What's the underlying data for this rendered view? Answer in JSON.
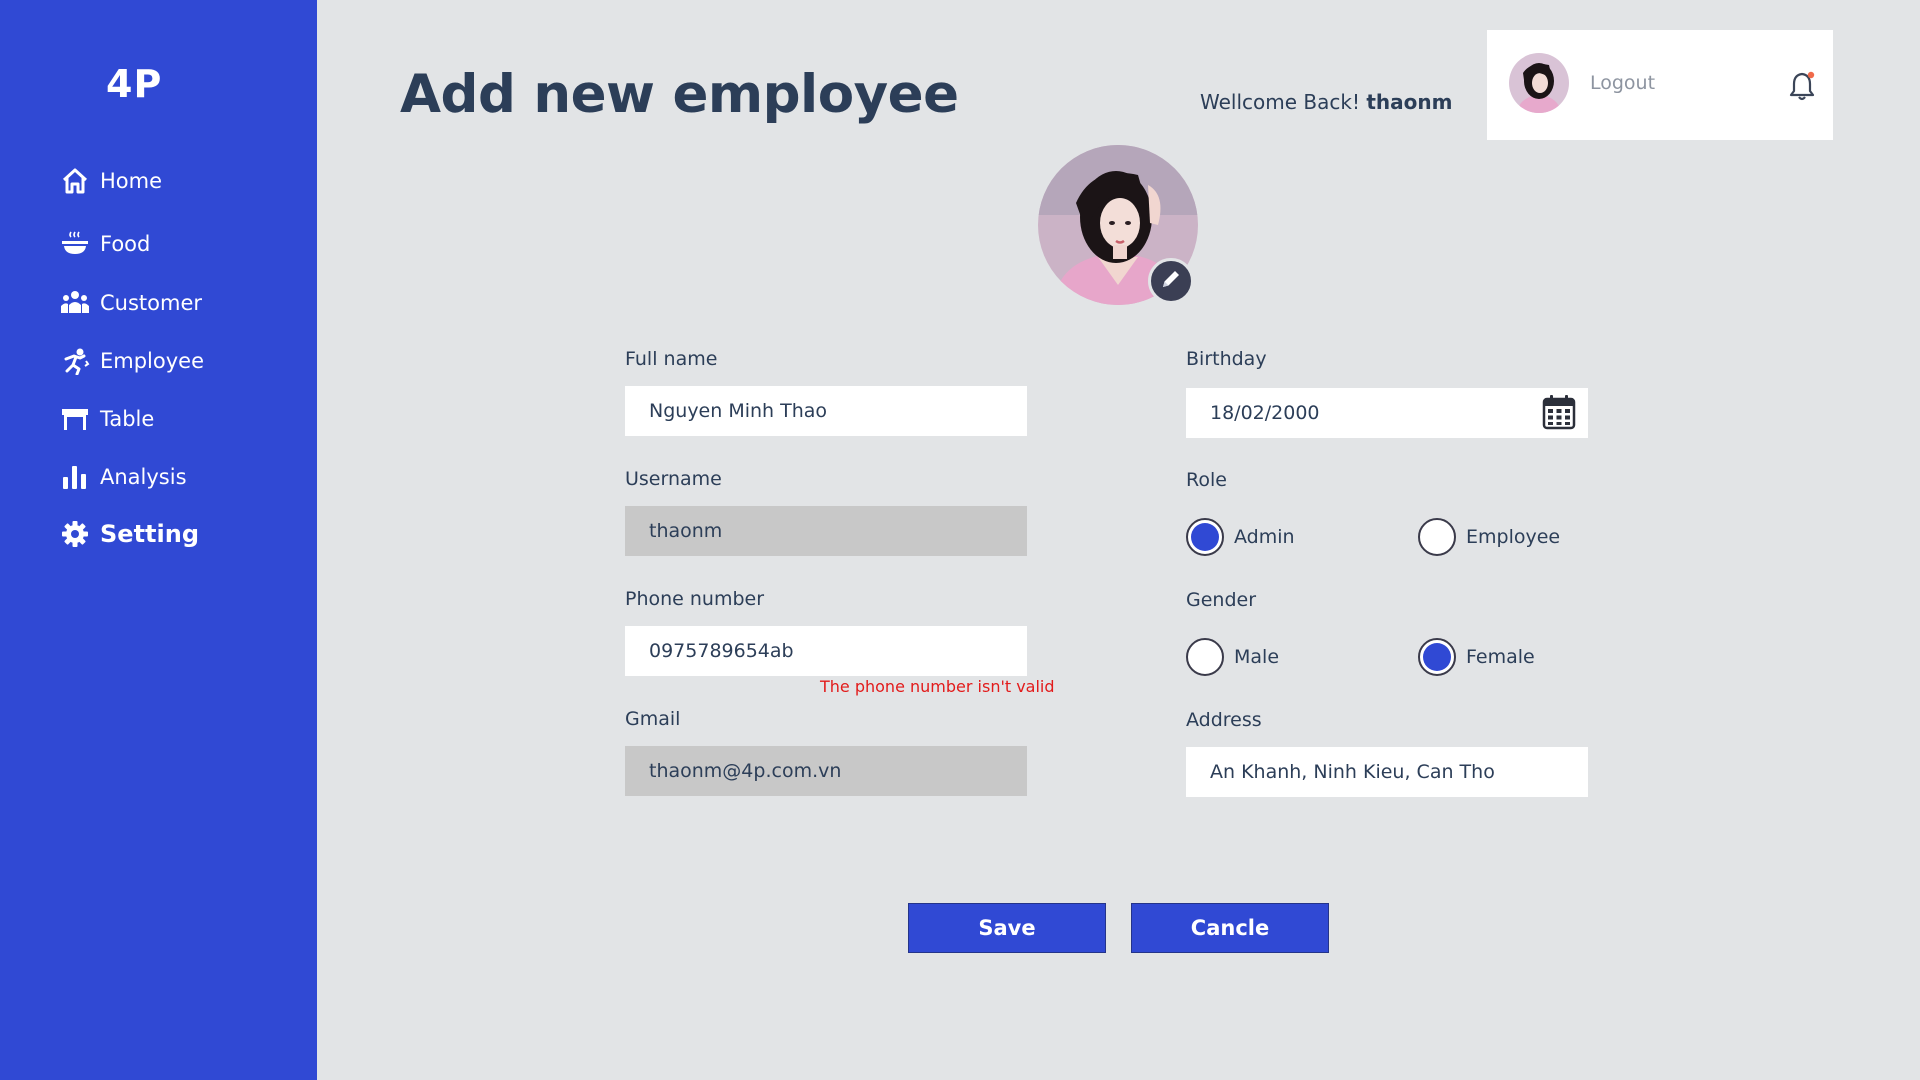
{
  "sidebar": {
    "logo": "4P",
    "items": [
      {
        "label": "Home",
        "icon": "home-icon"
      },
      {
        "label": "Food",
        "icon": "food-bowl-icon"
      },
      {
        "label": "Customer",
        "icon": "customers-icon"
      },
      {
        "label": "Employee",
        "icon": "employee-icon"
      },
      {
        "label": "Table",
        "icon": "table-icon"
      },
      {
        "label": "Analysis",
        "icon": "bar-chart-icon"
      },
      {
        "label": "Setting",
        "icon": "gear-icon",
        "active": true
      }
    ]
  },
  "header": {
    "title": "Add new employee",
    "welcome_prefix": "Wellcome Back!",
    "username": "thaonm",
    "logout_label": "Logout"
  },
  "form": {
    "full_name": {
      "label": "Full name",
      "value": "Nguyen Minh Thao"
    },
    "username": {
      "label": "Username",
      "value": "thaonm"
    },
    "phone": {
      "label": "Phone number",
      "value": "0975789654ab",
      "error": "The phone number isn't valid"
    },
    "gmail": {
      "label": "Gmail",
      "value": "thaonm@4p.com.vn"
    },
    "birthday": {
      "label": "Birthday",
      "value": "18/02/2000"
    },
    "role": {
      "label": "Role",
      "options": [
        "Admin",
        "Employee"
      ],
      "selected": "Admin"
    },
    "gender": {
      "label": "Gender",
      "options": [
        "Male",
        "Female"
      ],
      "selected": "Female"
    },
    "address": {
      "label": "Address",
      "value": "An Khanh, Ninh Kieu, Can Tho"
    }
  },
  "actions": {
    "save_label": "Save",
    "cancel_label": "Cancle"
  },
  "colors": {
    "accent": "#3049d4",
    "background": "#e2e4e6",
    "text": "#2c3e58",
    "error": "#e21b1b"
  }
}
